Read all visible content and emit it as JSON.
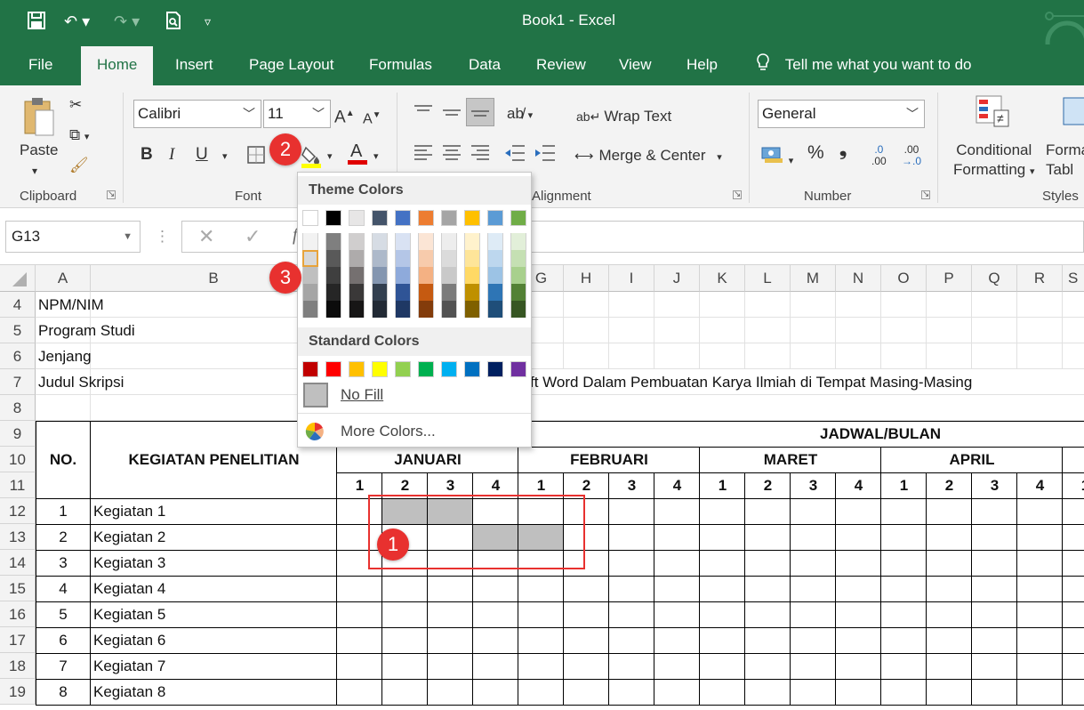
{
  "window": {
    "title": "Book1  -  Excel"
  },
  "tabs": [
    {
      "label": "File",
      "active": false
    },
    {
      "label": "Home",
      "active": true
    },
    {
      "label": "Insert",
      "active": false
    },
    {
      "label": "Page Layout",
      "active": false
    },
    {
      "label": "Formulas",
      "active": false
    },
    {
      "label": "Data",
      "active": false
    },
    {
      "label": "Review",
      "active": false
    },
    {
      "label": "View",
      "active": false
    },
    {
      "label": "Help",
      "active": false
    }
  ],
  "tell_me": "Tell me what you want to do",
  "ribbon": {
    "clipboard": {
      "paste": "Paste",
      "label": "Clipboard"
    },
    "font": {
      "name": "Calibri",
      "size": "11",
      "label": "Font",
      "bold": "B",
      "italic": "I",
      "underline": "U"
    },
    "alignment": {
      "wrap": "Wrap Text",
      "merge": "Merge & Center",
      "label": "Alignment"
    },
    "number": {
      "format": "General",
      "label": "Number",
      "percent": "%",
      "comma": "❟",
      "inc_dec": ".0",
      "inc_dec2": ".00",
      "dec_dec": ".00",
      "dec_dec2": "→.0"
    },
    "styles": {
      "cond1": "Conditional",
      "cond2": "Formatting",
      "fmt1": "Forma",
      "fmt2": "Tabl",
      "label": "Styles"
    }
  },
  "name_box": "G13",
  "columns": [
    "A",
    "B",
    "",
    "G",
    "H",
    "I",
    "J",
    "K",
    "L",
    "M",
    "N",
    "O",
    "P",
    "Q",
    "R",
    "S"
  ],
  "rows": [
    "4",
    "5",
    "6",
    "7",
    "8",
    "9",
    "10",
    "11",
    "12",
    "13",
    "14",
    "15",
    "16",
    "17",
    "18",
    "19"
  ],
  "labels": {
    "r4": "NPM/NIM",
    "r5": "Program Studi",
    "r6": "Jenjang",
    "r7": "Judul Skripsi",
    "r7_title": "ft Word Dalam Pembuatan Karya Ilmiah di Tempat Masing-Masing"
  },
  "table": {
    "no_header": "NO.",
    "activity_header": "KEGIATAN PENELITIAN",
    "schedule_header": "JADWAL/BULAN",
    "months": [
      "JANUARI",
      "FEBRUARI",
      "MARET",
      "APRIL"
    ],
    "weeks": [
      "1",
      "2",
      "3",
      "4",
      "1",
      "2",
      "3",
      "4",
      "1",
      "2",
      "3",
      "4",
      "1",
      "2",
      "3",
      "4",
      "1"
    ],
    "activities": [
      {
        "no": "1",
        "name": "Kegiatan 1"
      },
      {
        "no": "2",
        "name": "Kegiatan 2"
      },
      {
        "no": "3",
        "name": "Kegiatan 3"
      },
      {
        "no": "4",
        "name": "Kegiatan 4"
      },
      {
        "no": "5",
        "name": "Kegiatan 5"
      },
      {
        "no": "6",
        "name": "Kegiatan 6"
      },
      {
        "no": "7",
        "name": "Kegiatan 7"
      },
      {
        "no": "8",
        "name": "Kegiatan 8"
      }
    ]
  },
  "picker": {
    "theme_title": "Theme Colors",
    "standard_title": "Standard Colors",
    "no_fill": "No Fill",
    "more_colors": "More Colors...",
    "theme_top": [
      "#ffffff",
      "#000000",
      "#e7e6e6",
      "#44546a",
      "#4472c4",
      "#ed7d31",
      "#a5a5a5",
      "#ffc000",
      "#5b9bd5",
      "#70ad47"
    ],
    "theme_shades": [
      [
        "#f2f2f2",
        "#7f7f7f",
        "#d0cece",
        "#d6dce4",
        "#d9e2f3",
        "#fbe5d5",
        "#ededed",
        "#fff2cc",
        "#deebf6",
        "#e2efd9"
      ],
      [
        "#d8d8d8",
        "#595959",
        "#aeabab",
        "#adb9ca",
        "#b4c6e7",
        "#f7cbac",
        "#dbdbdb",
        "#fee599",
        "#bdd7ee",
        "#c5e0b3"
      ],
      [
        "#bfbfbf",
        "#3f3f3f",
        "#757070",
        "#8496b0",
        "#8eaadb",
        "#f4b183",
        "#c9c9c9",
        "#ffd965",
        "#9cc3e5",
        "#a8d08d"
      ],
      [
        "#a5a5a5",
        "#262626",
        "#3a3838",
        "#323f4f",
        "#2f5496",
        "#c55a11",
        "#7b7b7b",
        "#bf9000",
        "#2e75b5",
        "#538135"
      ],
      [
        "#7f7f7f",
        "#0c0c0c",
        "#171616",
        "#222a35",
        "#1f3864",
        "#833c0b",
        "#525252",
        "#7f6000",
        "#1f4e79",
        "#375623"
      ]
    ],
    "standard": [
      "#c00000",
      "#ff0000",
      "#ffc000",
      "#ffff00",
      "#92d050",
      "#00b050",
      "#00b0f0",
      "#0070c0",
      "#002060",
      "#7030a0"
    ]
  },
  "callouts": [
    "1",
    "2",
    "3"
  ],
  "colors": {
    "excel_green": "#217346",
    "highlight_gray": "#bfbfbf",
    "callout_red": "#e8312f"
  }
}
